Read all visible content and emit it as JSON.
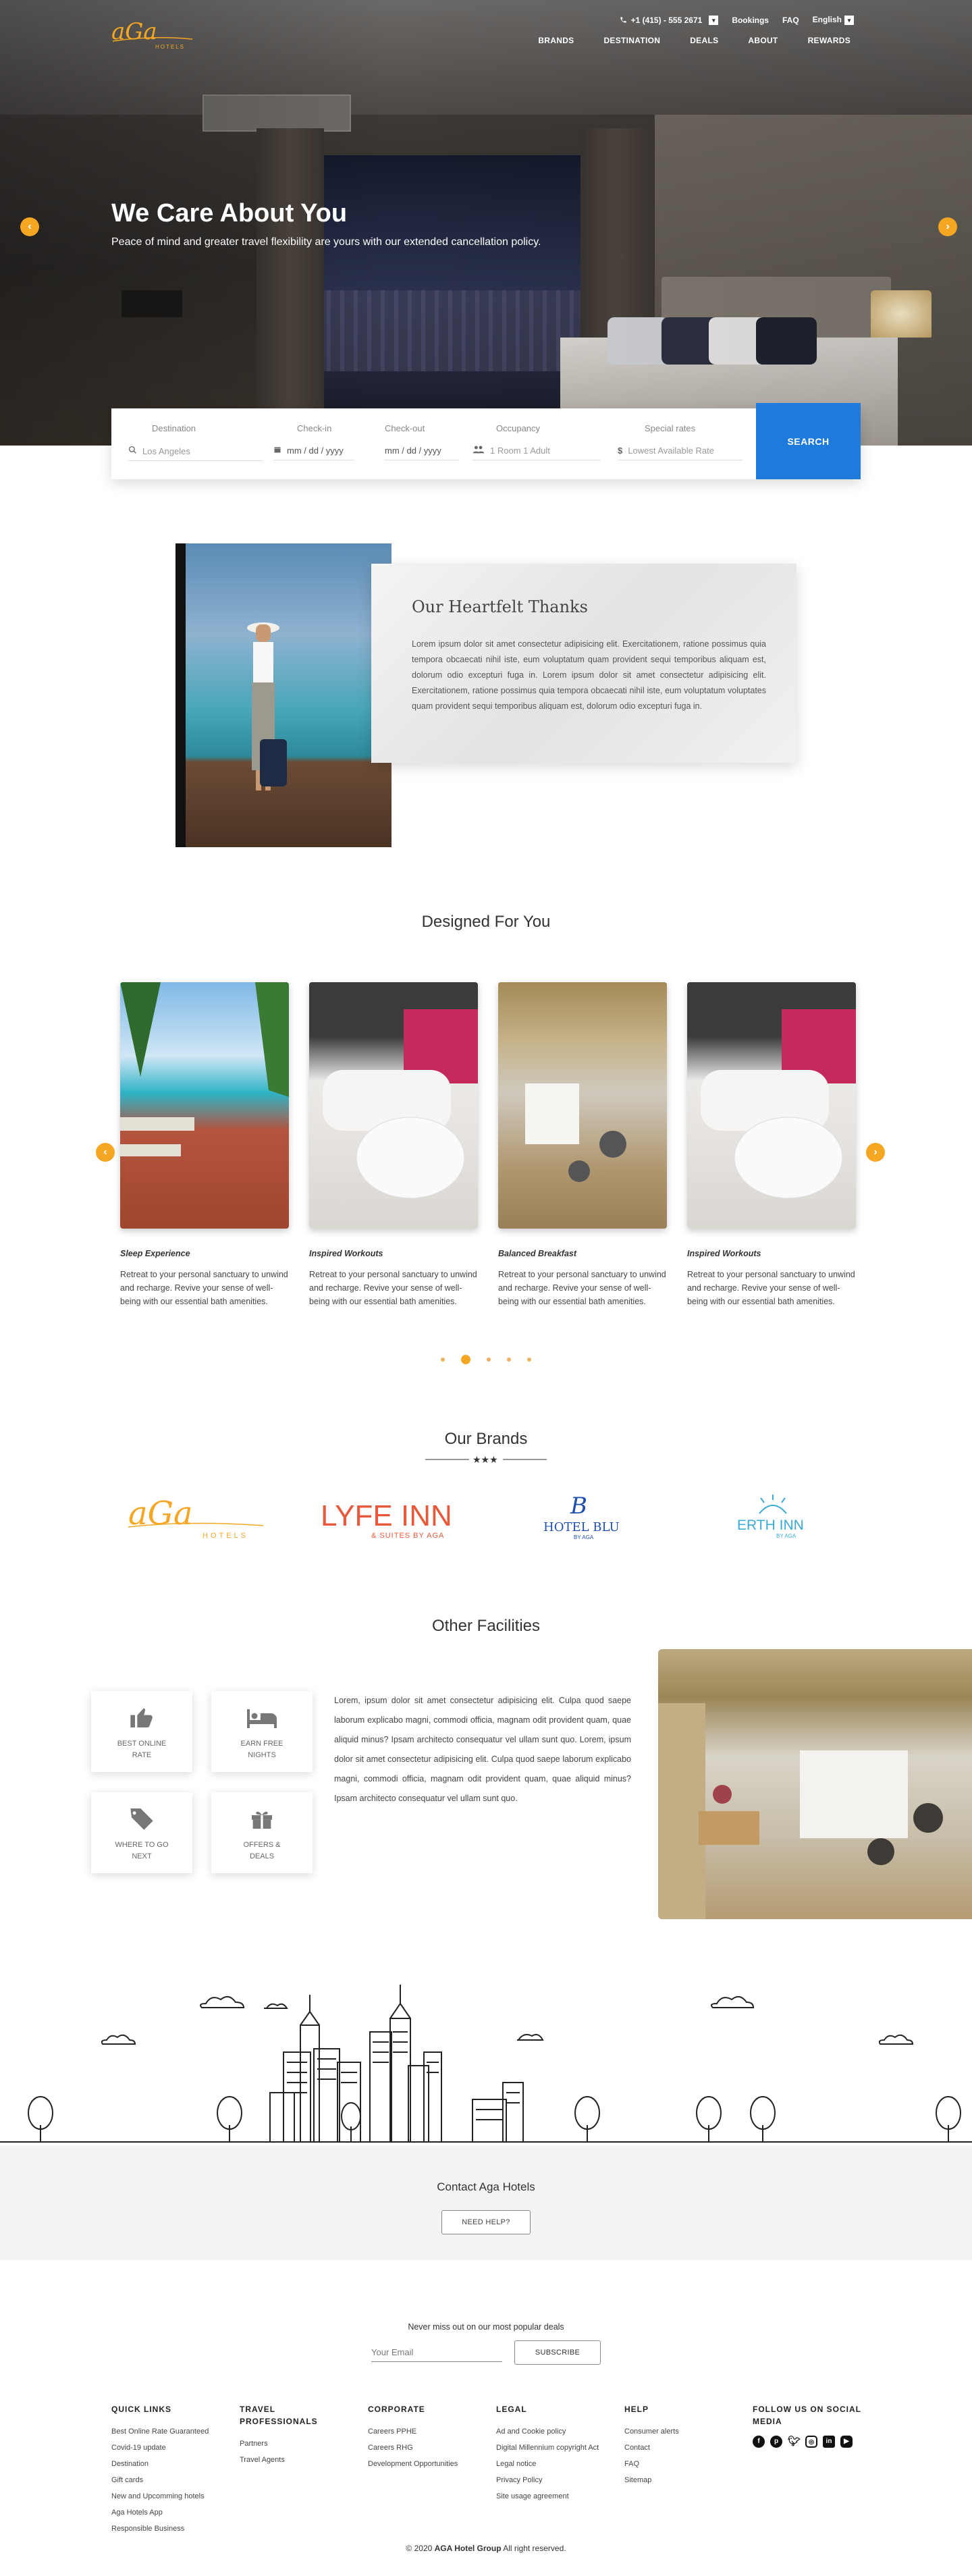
{
  "nav": {
    "phone": "+1 (415) - 555 2671",
    "bookings": "Bookings",
    "faq": "FAQ",
    "language": "English",
    "main": [
      "BRANDS",
      "DESTINATION",
      "DEALS",
      "ABOUT",
      "REWARDS"
    ],
    "logo_text": "aGa",
    "logo_sub": "HOTELS"
  },
  "hero": {
    "title": "We Care About You",
    "subtitle": "Peace of mind and greater travel flexibility are yours with our extended cancellation policy."
  },
  "booking": {
    "destination_label": "Destination",
    "destination_value": "Los Angeles",
    "checkin_label": "Check-in",
    "checkin_value": "mm / dd / yyyy",
    "checkout_label": "Check-out",
    "checkout_value": "mm / dd / yyyy",
    "occupancy_label": "Occupancy",
    "occupancy_value": "1 Room 1 Adult",
    "rates_label": "Special rates",
    "rates_value": "Lowest Available Rate",
    "search": "SEARCH"
  },
  "heartfelt": {
    "title": "Our Heartfelt Thanks",
    "body": "Lorem ipsum dolor sit amet consectetur adipisicing elit. Exercitationem, ratione possimus quia tempora obcaecati nihil iste, eum voluptatum quam provident sequi temporibus aliquam est, dolorum odio excepturi fuga in. Lorem ipsum dolor sit amet consectetur adipisicing elit. Exercitationem, ratione possimus quia tempora obcaecati nihil iste, eum voluptatum voluptates quam provident sequi temporibus aliquam est, dolorum odio excepturi fuga in."
  },
  "designed": {
    "title": "Designed For You",
    "cards": [
      {
        "caption": "Sleep Experience",
        "desc": "Retreat to your personal sanctuary to unwind and recharge. Revive your sense of well-being with our essential bath amenities."
      },
      {
        "caption": "Inspired Workouts",
        "desc": "Retreat to your personal sanctuary to unwind and recharge. Revive your sense of well-being with our essential bath amenities."
      },
      {
        "caption": "Balanced Breakfast",
        "desc": "Retreat to your personal sanctuary to unwind and recharge. Revive your sense of well-being with our essential bath amenities."
      },
      {
        "caption": "Inspired Workouts",
        "desc": "Retreat to your personal sanctuary to unwind and recharge. Revive your sense of well-being with our essential bath amenities."
      }
    ]
  },
  "brands": {
    "title": "Our Brands",
    "items": [
      {
        "name": "aGa",
        "sub": "HOTELS"
      },
      {
        "name": "LYFE INN",
        "sub": "& SUITES BY AGA"
      },
      {
        "name": "HOTEL BLU",
        "sub": "BY AGA"
      },
      {
        "name": "ERTH INN",
        "sub": "BY AGA"
      }
    ]
  },
  "facilities": {
    "title": "Other Facilities",
    "boxes": [
      "BEST ONLINE RATE",
      "EARN FREE NIGHTS",
      "WHERE TO GO NEXT",
      "OFFERS & DEALS"
    ],
    "text": "Lorem, ipsum dolor sit amet consectetur adipisicing elit. Culpa quod saepe laborum explicabo magni, commodi officia, magnam odit provident quam, quae aliquid minus? Ipsam architecto consequatur vel ullam sunt quo. Lorem, ipsum dolor sit amet consectetur adipisicing elit. Culpa quod saepe laborum explicabo magni, commodi officia, magnam odit provident quam, quae aliquid minus? Ipsam architecto consequatur vel ullam sunt quo."
  },
  "contact": {
    "title": "Contact Aga Hotels",
    "button": "NEED HELP?"
  },
  "newsletter": {
    "text": "Never miss out on our most popular deals",
    "placeholder": "Your Email",
    "button": "SUBSCRIBE"
  },
  "footer": {
    "quick_links": {
      "title": "QUICK LINKS",
      "items": [
        "Best Online Rate Guaranteed",
        "Covid-19 update",
        "Destination",
        "Gift cards",
        "New and Upcomming hotels",
        "Aga Hotels App",
        "Responsible Business"
      ]
    },
    "travel": {
      "title": "TRAVEL PROFESSIONALS",
      "items": [
        "Partners",
        "Travel Agents"
      ]
    },
    "corporate": {
      "title": "CORPORATE",
      "items": [
        "Careers PPHE",
        "Careers RHG",
        "Development Opportunities"
      ]
    },
    "legal": {
      "title": "LEGAL",
      "items": [
        "Ad and Cookie policy",
        "Digital Millennium copyright Act",
        "Legal notice",
        "Privacy Policy",
        "Site usage agreement"
      ]
    },
    "help": {
      "title": "HELP",
      "items": [
        "Consumer alerts",
        "Contact",
        "FAQ",
        "Sitemap"
      ]
    },
    "social": {
      "title": "FOLLOW US ON SOCIAL MEDIA"
    },
    "copyright_year": "© 2020",
    "copyright_brand": "AGA Hotel Group",
    "copyright_rest": "All right reserved."
  },
  "colors": {
    "accent": "#f5a623",
    "primary": "#1e7bdc"
  }
}
